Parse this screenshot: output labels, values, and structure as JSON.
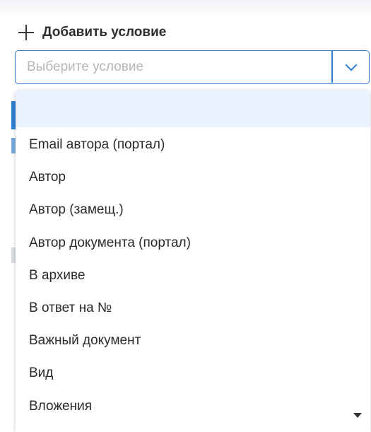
{
  "add_condition": {
    "icon": "plus-icon",
    "label": "Добавить условие"
  },
  "select": {
    "placeholder": "Выберите условие",
    "value": "",
    "toggle_icon": "chevron-down-icon",
    "accent_color": "#2f7fd3"
  },
  "dropdown": {
    "highlighted_background": "#e9f2fd",
    "options": [
      {
        "label": ""
      },
      {
        "label": "Email автора (портал)"
      },
      {
        "label": "Автор"
      },
      {
        "label": "Автор (замещ.)"
      },
      {
        "label": "Автор документа (портал)"
      },
      {
        "label": "В архиве"
      },
      {
        "label": "В ответ на №"
      },
      {
        "label": "Важный документ"
      },
      {
        "label": "Вид"
      },
      {
        "label": "Вложения"
      }
    ],
    "scroll_icon": "scroll-down-icon"
  }
}
